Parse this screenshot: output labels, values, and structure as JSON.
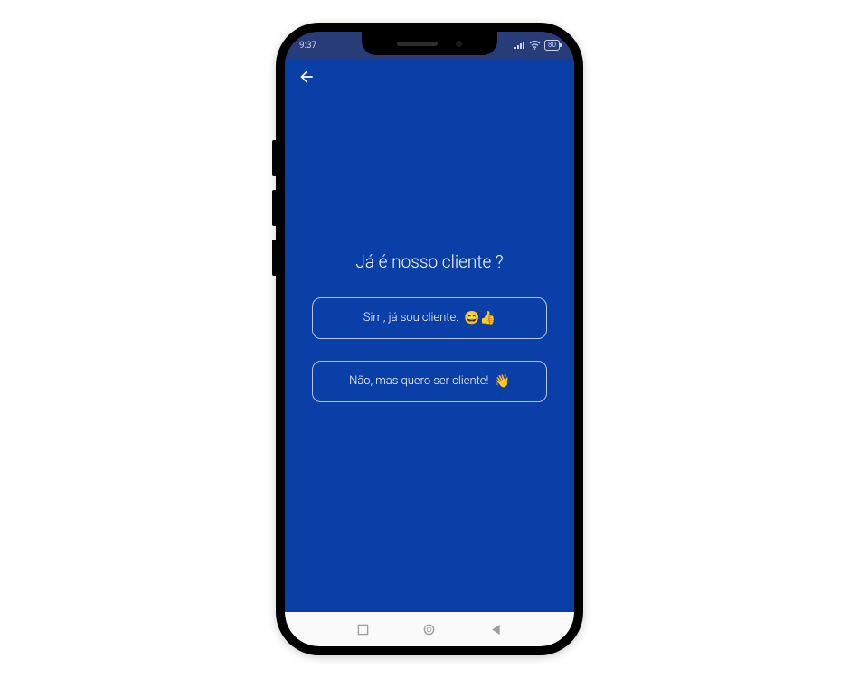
{
  "status": {
    "time": "9:37",
    "battery_text": "80"
  },
  "heading": "Já é nosso cliente ?",
  "options": {
    "yes": {
      "label": "Sim, já sou cliente.",
      "emoji": "😄👍"
    },
    "no": {
      "label": "Não, mas quero ser cliente!",
      "emoji": "👋"
    }
  },
  "icons": {
    "back": "back-arrow",
    "signal": "signal-icon",
    "wifi": "wifi-icon",
    "battery": "battery-icon",
    "nav_recent": "recent-apps",
    "nav_home": "home",
    "nav_back": "back"
  }
}
